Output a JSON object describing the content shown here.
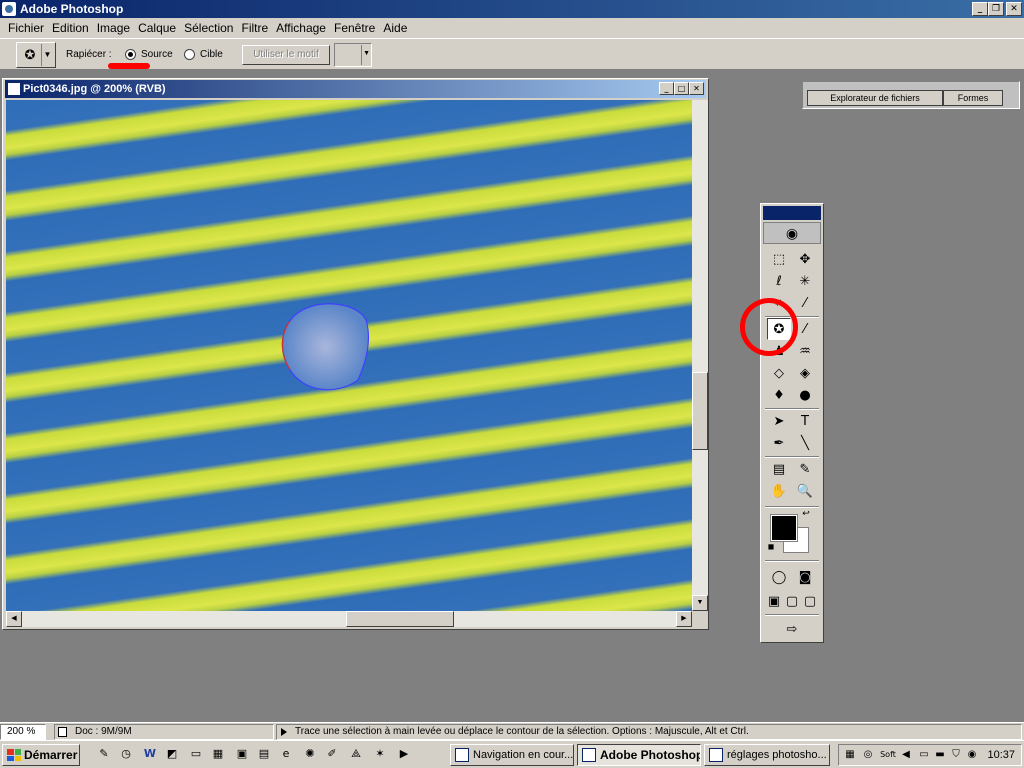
{
  "app": {
    "title": "Adobe Photoshop"
  },
  "window_controls": {
    "minimize": "_",
    "restore": "❐",
    "close": "✕"
  },
  "menu": [
    "Fichier",
    "Edition",
    "Image",
    "Calque",
    "Sélection",
    "Filtre",
    "Affichage",
    "Fenêtre",
    "Aide"
  ],
  "options": {
    "patch_label": "Rapiécer :",
    "source_label": "Source",
    "target_label": "Cible",
    "use_pattern": "Utiliser le motif",
    "selected": "Source"
  },
  "palette_well": {
    "tab1": "Explorateur de fichiers",
    "tab2": "Formes"
  },
  "document": {
    "title": "Pict0346.jpg @ 200% (RVB)"
  },
  "statusbar": {
    "zoom": "200 %",
    "doc_info": "Doc : 9M/9M",
    "hint": "Trace une sélection à main levée ou déplace le contour de la sélection. Options : Majuscule, Alt et Ctrl."
  },
  "taskbar": {
    "start": "Démarrer",
    "tasks": [
      "Navigation en cour...",
      "Adobe Photoshop",
      "réglages photosho..."
    ],
    "tray_label": "Soft",
    "clock": "10:37"
  },
  "colors": {
    "foreground": "#000000",
    "background": "#ffffff",
    "annotation": "#ff0000"
  },
  "tools": [
    "marquee-icon",
    "move-icon",
    "lasso-icon",
    "magic-wand-icon",
    "crop-icon",
    "slice-icon",
    "patch-icon",
    "brush-icon",
    "stamp-icon",
    "history-brush-icon",
    "eraser-icon",
    "bucket-icon",
    "blur-icon",
    "dodge-icon",
    "path-select-icon",
    "type-icon",
    "pen-icon",
    "line-icon",
    "notes-icon",
    "eyedropper-icon",
    "hand-icon",
    "zoom-icon"
  ]
}
